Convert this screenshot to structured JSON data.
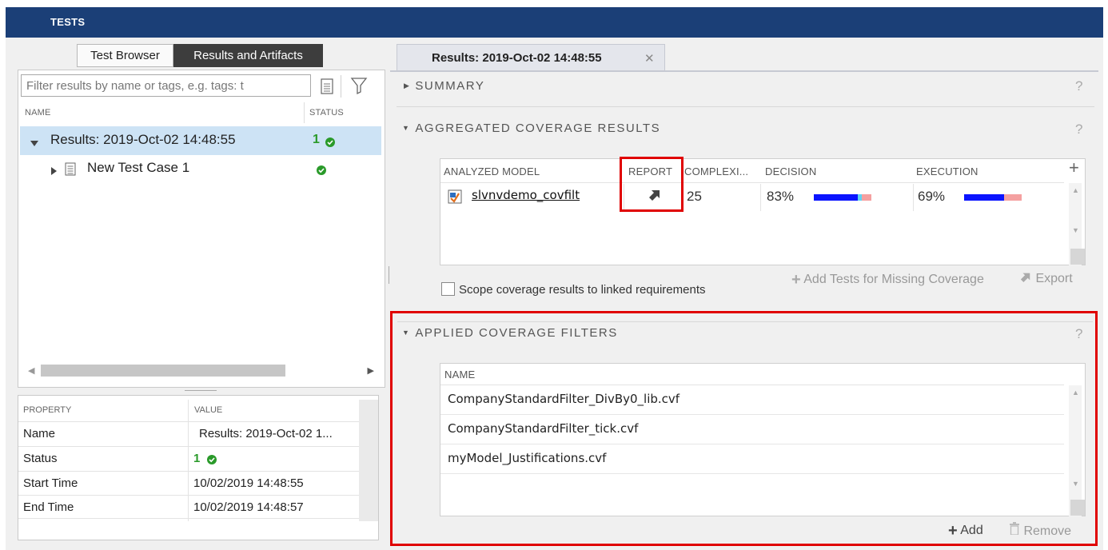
{
  "app": {
    "title": "TESTS"
  },
  "left_tabs": {
    "browser": "Test Browser",
    "results": "Results and Artifacts"
  },
  "filter": {
    "placeholder": "Filter results by name or tags, e.g. tags: t"
  },
  "tree": {
    "col_name": "NAME",
    "col_status": "STATUS",
    "rows": [
      {
        "label": "Results: 2019-Oct-02 14:48:55",
        "status_count": "1"
      },
      {
        "label": "New Test Case 1"
      }
    ]
  },
  "properties": {
    "col_property": "PROPERTY",
    "col_value": "VALUE",
    "rows": [
      {
        "key": "Name",
        "value": "Results: 2019-Oct-02 1..."
      },
      {
        "key": "Status",
        "value": "1"
      },
      {
        "key": "Start Time",
        "value": "10/02/2019 14:48:55"
      },
      {
        "key": "End Time",
        "value": "10/02/2019 14:48:57"
      }
    ]
  },
  "doc_tab": {
    "label": "Results: 2019-Oct-02 14:48:55",
    "close": "✕"
  },
  "summary": {
    "title": "SUMMARY",
    "help": "?"
  },
  "coverage": {
    "title": "AGGREGATED COVERAGE RESULTS",
    "help": "?",
    "columns": {
      "model": "ANALYZED MODEL",
      "report": "REPORT",
      "complexity": "COMPLEXI...",
      "decision": "DECISION",
      "execution": "EXECUTION"
    },
    "row": {
      "model": "slvnvdemo_covfilt",
      "complexity": "25",
      "decision": "83%",
      "decision_fraction": 0.83,
      "execution": "69%",
      "execution_fraction": 0.69
    },
    "scope_checkbox_label": "Scope coverage results to linked requirements",
    "add_tests": "Add Tests for Missing Coverage",
    "export": "Export"
  },
  "filters": {
    "title": "APPLIED COVERAGE FILTERS",
    "help": "?",
    "column": "NAME",
    "items": [
      "CompanyStandardFilter_DivBy0_lib.cvf",
      "CompanyStandardFilter_tick.cvf",
      "myModel_Justifications.cvf"
    ],
    "add": "Add",
    "remove": "Remove"
  },
  "colors": {
    "topbar": "#1b3f77",
    "selected_row": "#cde3f5",
    "pass_green": "#2a9a2a",
    "covered_blue": "#0a14ff",
    "justified_cyan": "#5fd3f2",
    "missed_red": "#f4a0a0",
    "highlight_red": "#e00000"
  },
  "icons": {
    "tree_expanded": "caret-down-icon",
    "tree_collapsed": "caret-right-icon",
    "pass": "check-circle-icon",
    "report": "arrow-up-right-icon",
    "model": "simulink-model-icon",
    "filter": "funnel-icon",
    "doc": "document-icon",
    "add": "plus-icon",
    "remove": "trash-icon"
  }
}
